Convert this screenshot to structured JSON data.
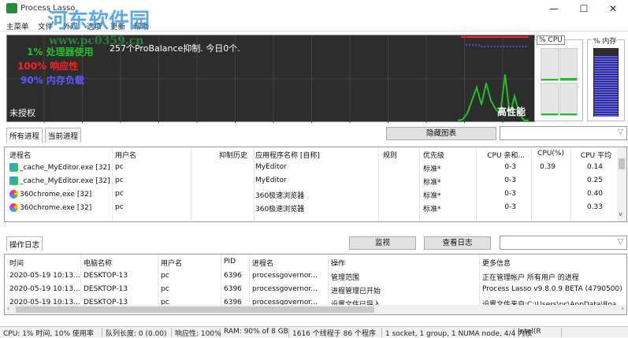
{
  "window": {
    "title": "Process Lasso",
    "minimize": "—",
    "maximize": "☐",
    "close": "✕"
  },
  "watermark": {
    "text": "河东软件园",
    "url": "www.pc0359.cn"
  },
  "menu": [
    "主菜单",
    "文件",
    "外观",
    "选项",
    "更新",
    "帮助"
  ],
  "graph": {
    "cpu_usage": "1% 处理器使用",
    "responsiveness": "100% 响应性",
    "memory_load": "90% 内存负载",
    "probalance": "257个ProBalance抑制. 今日0个.",
    "license": "未授权",
    "power_profile": "高性能",
    "colors": {
      "cpu": "#22c02a",
      "resp": "#ff2020",
      "mem": "#5a5aff"
    },
    "cpu_history": [
      2,
      3,
      10,
      25,
      40,
      20,
      45,
      25,
      15,
      10,
      55,
      8,
      30,
      10,
      2,
      2
    ]
  },
  "cpu_meter": {
    "label": "% CPU",
    "cores": [
      0,
      8,
      2,
      3
    ]
  },
  "mem_meter": {
    "label": "% 内存",
    "percent": 90
  },
  "process_tabs": [
    "所有进程",
    "当前进程"
  ],
  "hide_graph_button": "隐藏图表",
  "process_table": {
    "columns": [
      "进程名",
      "用户名",
      "抑制历史",
      "应用程序名称 [自称]",
      "规则",
      "优先级",
      "CPU 亲和...",
      "CPU(%)",
      "CPU 平均"
    ],
    "rows": [
      {
        "name": "_cache_MyEditor.exe [32]",
        "icon": "myeditor-icon",
        "user": "pc",
        "history": "",
        "app": "MyEditor",
        "rule": "",
        "priority": "标准*",
        "affinity": "0-3",
        "cpu": "0.39",
        "avg": "0.14"
      },
      {
        "name": "_cache_MyEditor.exe [32]",
        "icon": "myeditor-icon",
        "user": "pc",
        "history": "",
        "app": "MyEditor",
        "rule": "",
        "priority": "标准*",
        "affinity": "0-3",
        "cpu": "",
        "avg": "0.25"
      },
      {
        "name": "360chrome.exe [32]",
        "icon": "360chrome-icon",
        "user": "pc",
        "history": "",
        "app": "360极速浏览器",
        "rule": "",
        "priority": "标准*",
        "affinity": "0-3",
        "cpu": "",
        "avg": "0.40"
      },
      {
        "name": "360chrome.exe [32]",
        "icon": "360chrome-icon",
        "user": "pc",
        "history": "",
        "app": "360极速浏览器",
        "rule": "",
        "priority": "标准*",
        "affinity": "0-3",
        "cpu": "",
        "avg": "0.33"
      }
    ]
  },
  "log_tab": "操作日志",
  "monitor_button": "监视",
  "view_log_button": "查看日志",
  "log_table": {
    "columns": [
      "时间",
      "电脑名称",
      "用户名",
      "PID",
      "进程名",
      "操作",
      "更多信息"
    ],
    "rows": [
      [
        "2020-05-19 10:13...",
        "DESKTOP-13",
        "pc",
        "6396",
        "processgovernor...",
        "管理范围",
        "正在管理帐户 所有用户 的进程"
      ],
      [
        "2020-05-19 10:13...",
        "DESKTOP-13",
        "pc",
        "6396",
        "processgovernor...",
        "进程管理已开始",
        "Process Lasso v9.8.0.9 BETA (4790500)"
      ],
      [
        "2020-05-19 10:13...",
        "DESKTOP-13",
        "pc",
        "6396",
        "processgovernor...",
        "设置文件已导入",
        "设置文件来自:C:\\Users\\pc\\AppData\\Roa"
      ]
    ]
  },
  "status": [
    "CPU: 1% 时间, 10% 使用率",
    "队列长度: 0 (0.00)",
    "响应性: 100%",
    "RAM: 90% of 8 GB",
    "1616 个线程于 86 个程序",
    "1 socket, 1 group, 1 NUMA node, 4/4 内核",
    "Intel(R"
  ]
}
